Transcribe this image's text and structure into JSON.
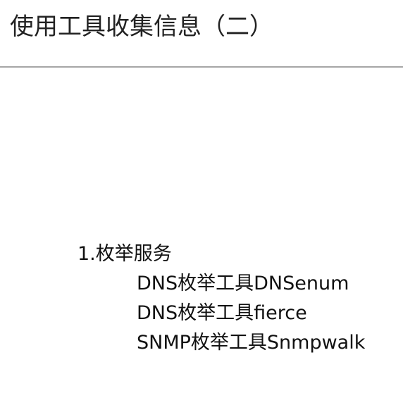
{
  "slide": {
    "title": "使用工具收集信息（二）",
    "section": {
      "heading": "1.枚举服务",
      "items": [
        "DNS枚举工具DNSenum",
        "DNS枚举工具fierce",
        "SNMP枚举工具Snmpwalk"
      ]
    }
  }
}
